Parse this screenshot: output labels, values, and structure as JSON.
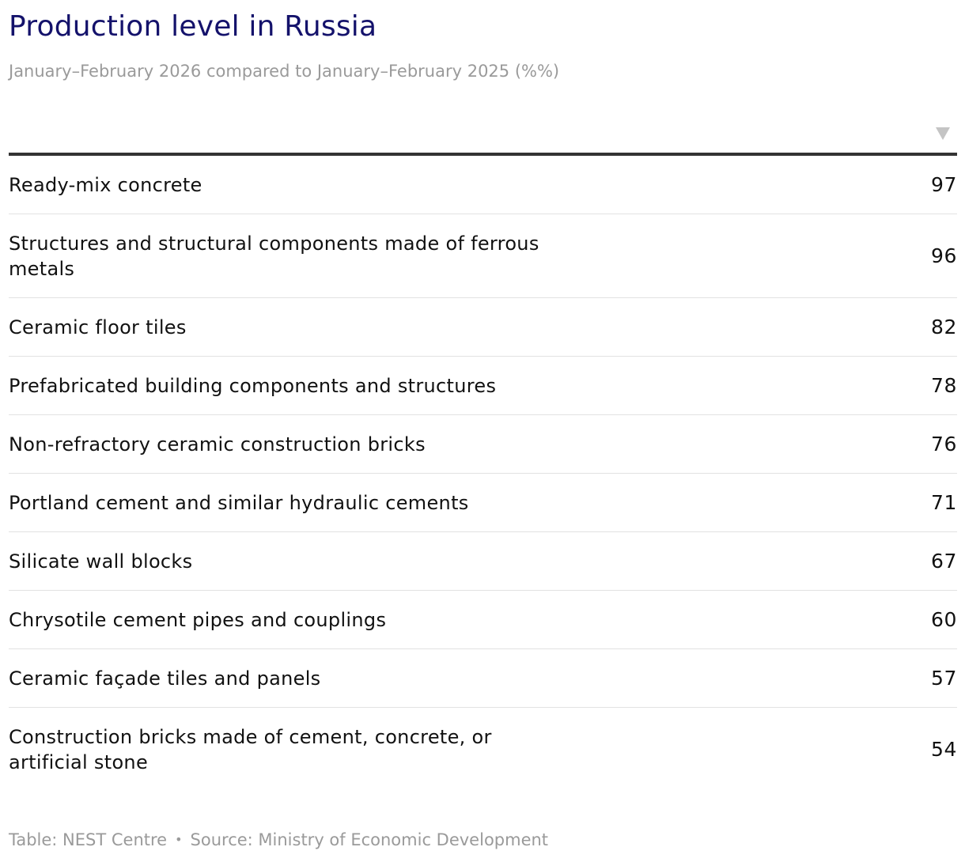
{
  "header": {
    "title": "Production level in Russia",
    "subtitle": "January–February 2026 compared to January–February 2025 (%%)",
    "sort_icon": "triangle-down-icon"
  },
  "chart_data": {
    "type": "table",
    "title": "Production level in Russia",
    "subtitle": "January–February 2026 compared to January–February 2025 (%%)",
    "rows": [
      {
        "label": "Ready-mix concrete",
        "value": "97"
      },
      {
        "label": "Structures and structural components made of ferrous metals",
        "value": "96"
      },
      {
        "label": "Ceramic floor tiles",
        "value": "82"
      },
      {
        "label": "Prefabricated building components and structures",
        "value": "78"
      },
      {
        "label": "Non-refractory ceramic construction bricks",
        "value": "76"
      },
      {
        "label": "Portland cement and similar hydraulic cements",
        "value": "71"
      },
      {
        "label": "Silicate wall blocks",
        "value": "67"
      },
      {
        "label": "Chrysotile cement pipes and couplings",
        "value": "60"
      },
      {
        "label": "Ceramic façade tiles and panels",
        "value": "57"
      },
      {
        "label": "Construction bricks made of cement, concrete, or artificial stone",
        "value": "54"
      }
    ]
  },
  "footer": {
    "table_credit": "Table: NEST Centre",
    "separator": "•",
    "source": "Source: Ministry of Economic Development"
  },
  "colors": {
    "title": "#14126b",
    "muted": "#9a9a9a",
    "rule": "#333333",
    "row_divider": "#e2e2e2"
  }
}
